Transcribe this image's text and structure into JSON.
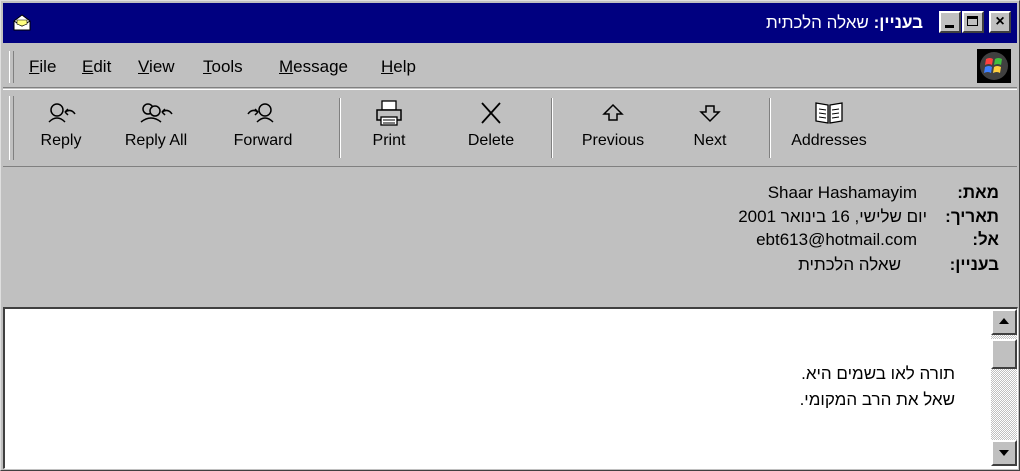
{
  "window": {
    "title_label": "בעניין:",
    "title_subject": "שאלה הלכתית",
    "controls": {
      "minimize": "",
      "maximize": "",
      "close": "×"
    },
    "app_icon": "mail-envelope-icon",
    "title_bar_color": "#000080"
  },
  "menu": {
    "items": [
      {
        "first": "F",
        "rest": "ile"
      },
      {
        "first": "E",
        "rest": "dit"
      },
      {
        "first": "V",
        "rest": "iew"
      },
      {
        "first": "T",
        "rest": "ools"
      },
      {
        "first": "M",
        "rest": "essage"
      },
      {
        "first": "H",
        "rest": "elp"
      }
    ],
    "logo_icon": "windows-logo-icon"
  },
  "toolbar": {
    "buttons": [
      {
        "label": "Reply",
        "icon": "reply-icon"
      },
      {
        "label": "Reply All",
        "icon": "reply-all-icon"
      },
      {
        "label": "Forward",
        "icon": "forward-icon"
      },
      {
        "label": "Print",
        "icon": "print-icon"
      },
      {
        "label": "Delete",
        "icon": "delete-icon"
      },
      {
        "label": "Previous",
        "icon": "up-arrow-icon"
      },
      {
        "label": "Next",
        "icon": "down-arrow-icon"
      },
      {
        "label": "Addresses",
        "icon": "address-book-icon"
      }
    ]
  },
  "header": {
    "from_label": "מאת:",
    "from_value": "Shaar Hashamayim",
    "date_label": "תאריך:",
    "date_value": "יום שלישי, 16 בינואר 2001",
    "to_label": "אל:",
    "to_value": "ebt613@hotmail.com",
    "subject_label": "בעניין:",
    "subject_value": "שאלה הלכתית"
  },
  "body": {
    "lines": [
      "תורה לאו בשמים היא.",
      "שאל את הרב המקומי."
    ]
  }
}
